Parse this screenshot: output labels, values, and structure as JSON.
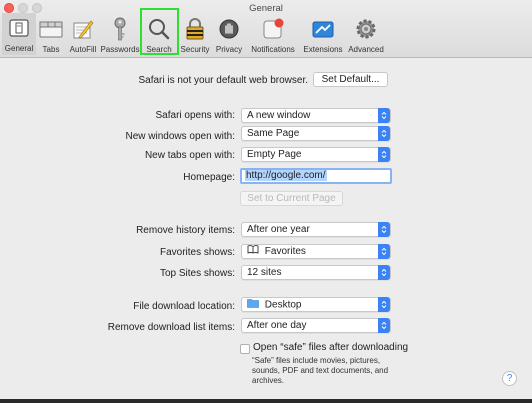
{
  "window": {
    "title": "General"
  },
  "tabs": [
    {
      "label": "General"
    },
    {
      "label": "Tabs"
    },
    {
      "label": "AutoFill"
    },
    {
      "label": "Passwords"
    },
    {
      "label": "Search"
    },
    {
      "label": "Security"
    },
    {
      "label": "Privacy"
    },
    {
      "label": "Notifications"
    },
    {
      "label": "Extensions"
    },
    {
      "label": "Advanced"
    }
  ],
  "default_browser": {
    "message": "Safari is not your default web browser.",
    "button": "Set Default..."
  },
  "opens_with": {
    "label": "Safari opens with:",
    "value": "A new window"
  },
  "new_windows": {
    "label": "New windows open with:",
    "value": "Same Page"
  },
  "new_tabs": {
    "label": "New tabs open with:",
    "value": "Empty Page"
  },
  "homepage": {
    "label": "Homepage:",
    "value": "http://google.com/",
    "set_current": "Set to Current Page"
  },
  "remove_history": {
    "label": "Remove history items:",
    "value": "After one year"
  },
  "favorites": {
    "label": "Favorites shows:",
    "value": "Favorites"
  },
  "top_sites": {
    "label": "Top Sites shows:",
    "value": "12 sites"
  },
  "download_location": {
    "label": "File download location:",
    "value": "Desktop"
  },
  "remove_downloads": {
    "label": "Remove download list items:",
    "value": "After one day"
  },
  "safe_files": {
    "label": "Open “safe” files after downloading",
    "desc1": "“Safe” files include movies, pictures,",
    "desc2": "sounds, PDF and text documents, and",
    "desc3": "archives.",
    "checked": false
  },
  "help": {
    "label": "?"
  },
  "colors": {
    "accent": "#3b82f6",
    "highlight": "#2ee02e"
  }
}
